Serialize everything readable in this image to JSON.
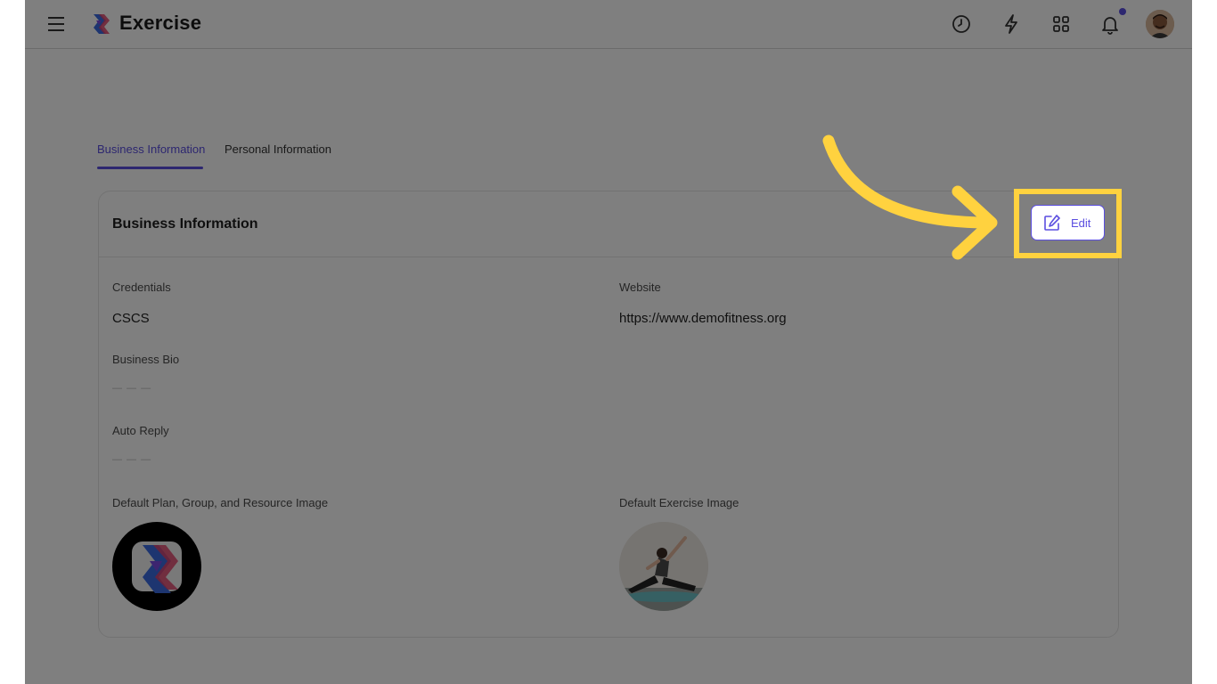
{
  "app": {
    "title": "Exercise"
  },
  "colors": {
    "accent": "#5b4ee0",
    "highlight": "#ffd23f",
    "notification_dot": "#5b4ee0"
  },
  "header": {
    "icons": [
      "menu-icon",
      "app-logo",
      "clock-icon",
      "lightning-icon",
      "grid-icon",
      "bell-icon",
      "avatar"
    ]
  },
  "tabs": [
    {
      "label": "Business Information",
      "active": true
    },
    {
      "label": "Personal Information",
      "active": false
    }
  ],
  "card": {
    "title": "Business Information",
    "edit_label": "Edit",
    "fields": {
      "credentials": {
        "label": "Credentials",
        "value": "CSCS"
      },
      "website": {
        "label": "Website",
        "value": "https://www.demofitness.org"
      },
      "business_bio": {
        "label": "Business Bio",
        "value": "— — —"
      },
      "auto_reply": {
        "label": "Auto Reply",
        "value": "— — —"
      },
      "default_plan_image": {
        "label": "Default Plan, Group, and Resource Image"
      },
      "default_exercise_image": {
        "label": "Default Exercise Image"
      }
    }
  }
}
